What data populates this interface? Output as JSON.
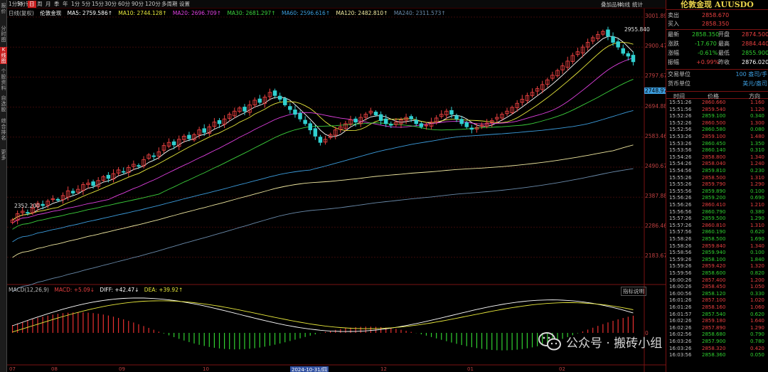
{
  "left_tabs": [
    "报价",
    "分时图",
    "K线图",
    "个股资料",
    "自选股",
    "综合排名",
    "更多"
  ],
  "top_toolbar": {
    "periods": [
      "1分钟",
      "5分钟",
      "日",
      "周",
      "月",
      "季",
      "年",
      "1分",
      "5分",
      "15分",
      "30分",
      "60分",
      "90分",
      "120分",
      "多周期",
      "设置"
    ],
    "active_period": "日",
    "right_items": [
      "叠加品种",
      "均线",
      "统计"
    ]
  },
  "ma_legend": {
    "label": "日线(复权)",
    "name": "伦敦金现",
    "items": [
      {
        "text": "MA5: 2759.586↑",
        "color": "#ffffff"
      },
      {
        "text": "MA10: 2744.128↑",
        "color": "#e8e83c"
      },
      {
        "text": "MA20: 2696.709↑",
        "color": "#e040e0"
      },
      {
        "text": "MA30: 2681.297↑",
        "color": "#3cd03c"
      },
      {
        "text": "MA60: 2596.616↑",
        "color": "#3c9cdc"
      },
      {
        "text": "MA120: 2482.810↑",
        "color": "#f0e8a0"
      },
      {
        "text": "MA240: 2311.573↑",
        "color": "#6a8aaa"
      }
    ]
  },
  "price_ticks": [
    "3001.890",
    "2900.470",
    "2797.675",
    "2694.888",
    "2583.466",
    "2490.673",
    "2387.886",
    "2286.466",
    "2183.675"
  ],
  "current_price_tag": "2748.972",
  "high_label": "2955.840",
  "low_label": "2352.200",
  "macd_legend": {
    "title": "MACD(12,26,9)",
    "macd": "MACD: +5.09↓",
    "diff": "DIFF: +42.47↓",
    "dea": "DEA: +39.92↑",
    "button": "指标说明"
  },
  "macd_zero_label": "0",
  "x_ticks": [
    "07",
    "08",
    "09",
    "10",
    "2024-10-31/四",
    "12",
    "01",
    "02"
  ],
  "right_panel": {
    "title": "伦敦金现 AUUSDO",
    "quote": [
      {
        "l": "卖出",
        "v": "2858.670"
      },
      {
        "l": "买入",
        "v": "2858.350"
      }
    ],
    "stats": [
      {
        "l1": "最新",
        "v1": "2858.350",
        "l2": "开盘",
        "v2": "2874.500"
      },
      {
        "l1": "涨跌",
        "v1": "-17.670",
        "l2": "最高",
        "v2": "2884.440"
      },
      {
        "l1": "涨幅",
        "v1": "-0.61%",
        "l2": "最低",
        "v2": "2855.900"
      },
      {
        "l1": "振幅",
        "v1": "+0.99%",
        "l2": "昨收",
        "v2": "2876.020"
      }
    ],
    "units": [
      {
        "l": "交易单位",
        "v": "100 盎司/手"
      },
      {
        "l": "货币单位",
        "v": "美元/盎司"
      }
    ],
    "trade_header": [
      "时间",
      "价格",
      "方向"
    ],
    "trades": [
      [
        "15:51:26",
        "2860.660",
        "1.160"
      ],
      [
        "15:51:56",
        "2859.540",
        "1.120"
      ],
      [
        "15:52:26",
        "2859.100",
        "0.340"
      ],
      [
        "15:52:26",
        "2860.500",
        "1.300"
      ],
      [
        "15:52:56",
        "2860.580",
        "0.080"
      ],
      [
        "15:53:26",
        "2859.100",
        "1.480"
      ],
      [
        "15:53:26",
        "2860.450",
        "1.350"
      ],
      [
        "15:53:56",
        "2860.140",
        "0.310"
      ],
      [
        "15:54:26",
        "2858.800",
        "1.340"
      ],
      [
        "15:54:26",
        "2858.040",
        "1.240"
      ],
      [
        "15:54:56",
        "2859.810",
        "0.230"
      ],
      [
        "15:55:26",
        "2858.500",
        "1.310"
      ],
      [
        "15:55:26",
        "2859.790",
        "1.290"
      ],
      [
        "15:55:56",
        "2859.890",
        "0.100"
      ],
      [
        "15:56:26",
        "2859.200",
        "0.690"
      ],
      [
        "15:56:26",
        "2860.410",
        "1.210"
      ],
      [
        "15:56:56",
        "2860.790",
        "0.380"
      ],
      [
        "15:57:26",
        "2859.500",
        "1.290"
      ],
      [
        "15:57:26",
        "2860.810",
        "1.310"
      ],
      [
        "15:57:56",
        "2860.190",
        "0.620"
      ],
      [
        "15:58:26",
        "2858.500",
        "1.690"
      ],
      [
        "15:58:26",
        "2859.840",
        "1.340"
      ],
      [
        "15:58:56",
        "2859.940",
        "0.100"
      ],
      [
        "15:59:26",
        "2858.100",
        "1.840"
      ],
      [
        "15:59:26",
        "2859.420",
        "1.320"
      ],
      [
        "15:59:56",
        "2858.600",
        "0.820"
      ],
      [
        "16:00:26",
        "2857.400",
        "1.200"
      ],
      [
        "16:00:26",
        "2858.450",
        "1.050"
      ],
      [
        "16:00:56",
        "2858.120",
        "0.330"
      ],
      [
        "16:01:26",
        "2857.100",
        "1.020"
      ],
      [
        "16:01:26",
        "2858.160",
        "1.060"
      ],
      [
        "16:01:57",
        "2857.540",
        "0.620"
      ],
      [
        "16:02:26",
        "2859.180",
        "1.640"
      ],
      [
        "16:02:26",
        "2857.890",
        "1.290"
      ],
      [
        "16:02:56",
        "2858.680",
        "0.790"
      ],
      [
        "16:03:26",
        "2857.900",
        "0.780"
      ],
      [
        "16:03:26",
        "2858.320",
        "0.420"
      ],
      [
        "16:03:56",
        "2858.360",
        "0.050"
      ]
    ],
    "trade_dir_colors": [
      "#e84040",
      "#e84040",
      "#30d030",
      "#e84040",
      "#30d030",
      "#e84040",
      "#30d030",
      "#30d030",
      "#e84040",
      "#e84040",
      "#30d030",
      "#e84040",
      "#e84040",
      "#30d030",
      "#30d030",
      "#e84040",
      "#30d030",
      "#30d030",
      "#e84040",
      "#30d030",
      "#30d030",
      "#e84040",
      "#30d030",
      "#30d030",
      "#e84040",
      "#30d030",
      "#e84040",
      "#e84040",
      "#30d030",
      "#e84040",
      "#e84040",
      "#30d030",
      "#e84040",
      "#e84040",
      "#30d030",
      "#30d030",
      "#e84040",
      "#30d030"
    ]
  },
  "watermark": "公众号 · 搬砖小组",
  "colors": {
    "up": "#e84040",
    "down": "#30d0d0",
    "macd_up": "#e83030",
    "macd_down": "#30d030",
    "grid": "#3a0a0a"
  },
  "chart_data": {
    "type": "candlestick",
    "title": "伦敦金现",
    "period": "日",
    "ylim": [
      2150,
      3010
    ],
    "highest": 2955.84,
    "lowest": 2352.2,
    "close_series": [
      2352,
      2372,
      2380,
      2375,
      2390,
      2405,
      2398,
      2412,
      2420,
      2415,
      2430,
      2445,
      2438,
      2450,
      2465,
      2470,
      2462,
      2478,
      2490,
      2485,
      2500,
      2512,
      2505,
      2520,
      2530,
      2525,
      2545,
      2560,
      2555,
      2570,
      2590,
      2600,
      2592,
      2610,
      2620,
      2612,
      2625,
      2640,
      2632,
      2650,
      2665,
      2660,
      2675,
      2690,
      2700,
      2710,
      2700,
      2720,
      2735,
      2728,
      2745,
      2760,
      2750,
      2738,
      2720,
      2705,
      2690,
      2675,
      2660,
      2640,
      2620,
      2600,
      2610,
      2625,
      2640,
      2650,
      2660,
      2672,
      2665,
      2680,
      2690,
      2700,
      2688,
      2670,
      2660,
      2655,
      2665,
      2672,
      2680,
      2675,
      2660,
      2650,
      2655,
      2665,
      2678,
      2690,
      2700,
      2690,
      2675,
      2660,
      2650,
      2642,
      2648,
      2655,
      2662,
      2670,
      2680,
      2690,
      2700,
      2712,
      2725,
      2738,
      2750,
      2760,
      2772,
      2785,
      2800,
      2815,
      2830,
      2845,
      2860,
      2878,
      2890,
      2905,
      2920,
      2935,
      2945,
      2955,
      2940,
      2920,
      2905,
      2885,
      2876,
      2858
    ],
    "ma_series": [
      "MA5",
      "MA10",
      "MA20",
      "MA30",
      "MA60",
      "MA120",
      "MA240"
    ],
    "macd": {
      "diff": 42.47,
      "dea": 39.92,
      "macd": 5.09
    }
  }
}
